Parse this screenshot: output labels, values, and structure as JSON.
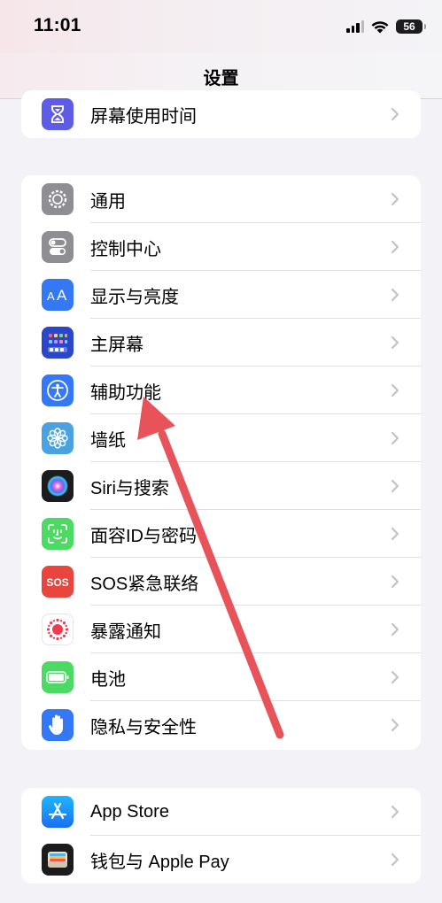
{
  "status": {
    "time": "11:01",
    "battery": "56"
  },
  "nav": {
    "title": "设置"
  },
  "group_top": [
    {
      "label": "屏幕使用时间",
      "icon": "hourglass-icon",
      "color": "#5e5ce6"
    }
  ],
  "group_main": [
    {
      "label": "通用",
      "icon": "gear-icon",
      "color": "#8e8e93"
    },
    {
      "label": "控制中心",
      "icon": "toggles-icon",
      "color": "#8e8e93"
    },
    {
      "label": "显示与亮度",
      "icon": "text-size-icon",
      "color": "#3478f6"
    },
    {
      "label": "主屏幕",
      "icon": "home-screen-grid-icon",
      "color": "#2c46c9"
    },
    {
      "label": "辅助功能",
      "icon": "accessibility-icon",
      "color": "#3478f6"
    },
    {
      "label": "墙纸",
      "icon": "flower-icon",
      "color": "#4aa3e0"
    },
    {
      "label": "Siri与搜索",
      "icon": "siri-orb-icon",
      "color": "#1c1c1e"
    },
    {
      "label": "面容ID与密码",
      "icon": "face-id-icon",
      "color": "#4cd964"
    },
    {
      "label": "SOS紧急联络",
      "icon": "sos-icon",
      "color": "#e8453c"
    },
    {
      "label": "暴露通知",
      "icon": "exposure-dots-icon",
      "color": "#ffffff"
    },
    {
      "label": "电池",
      "icon": "battery-icon",
      "color": "#4cd964"
    },
    {
      "label": "隐私与安全性",
      "icon": "hand-icon",
      "color": "#3478f6"
    }
  ],
  "group_bottom": [
    {
      "label": "App Store",
      "icon": "app-store-icon",
      "color": "#1e8ef5"
    },
    {
      "label": "钱包与 Apple Pay",
      "icon": "wallet-icon",
      "color": "#1c1c1e"
    }
  ],
  "annotation": {
    "arrow_color": "#e8535a"
  }
}
